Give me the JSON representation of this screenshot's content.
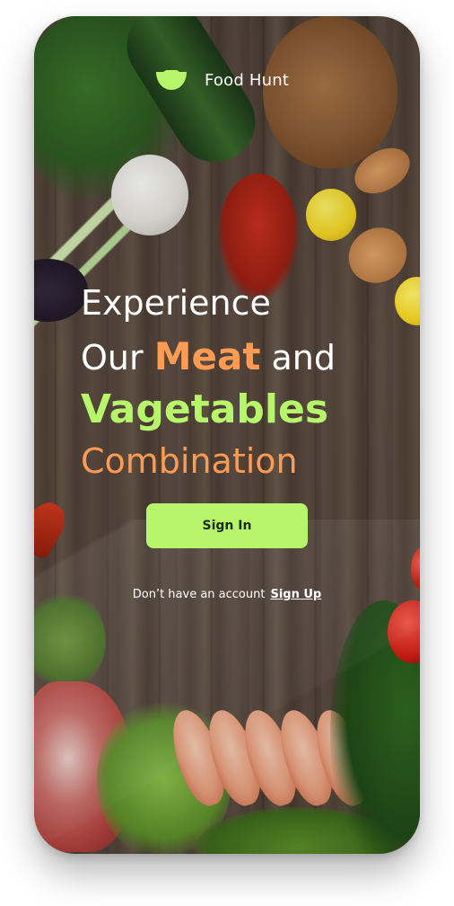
{
  "app": {
    "brand_name": "Food Hunt",
    "icons": {
      "logo": "bowl-icon"
    }
  },
  "hero": {
    "line1": "Experience",
    "line2_prefix": "Our",
    "line2_highlight": "Meat",
    "line2_suffix": "and",
    "line3": "Vagetables",
    "line4": "Combination"
  },
  "actions": {
    "sign_in_label": "Sign In",
    "no_account_text": "Don’t have an account",
    "sign_up_label": "Sign Up"
  },
  "colors": {
    "accent_green": "#b7f56b",
    "accent_orange": "#ff9b52",
    "text_white": "#ffffff"
  }
}
